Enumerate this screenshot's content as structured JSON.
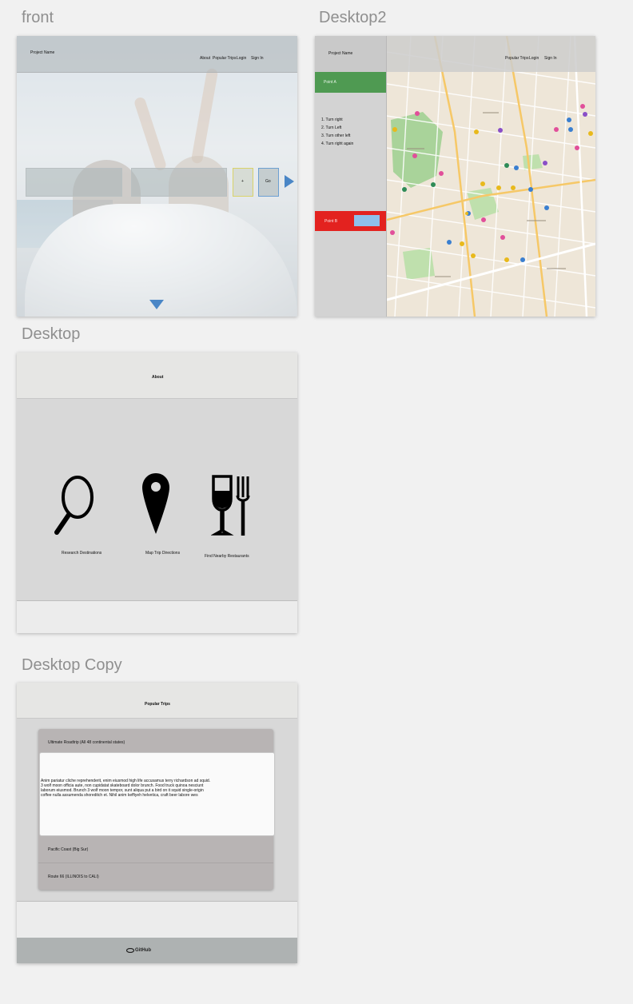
{
  "artboards": {
    "front": {
      "title": "front",
      "project_name": "Project Name",
      "nav": [
        "About",
        "Popular Trips",
        "Login",
        "Sign In"
      ],
      "plus_label": "+",
      "go_label": "Go"
    },
    "desktop2": {
      "title": "Desktop2",
      "project_name": "Project Name",
      "nav": [
        "Popular Trips",
        "Login",
        "Sign In"
      ],
      "point_a": "Point A",
      "point_b": "Point B",
      "directions": [
        "1. Turn right",
        "2. Turn Left",
        "3. Turn other left",
        "4. Turn right again"
      ]
    },
    "desktop": {
      "title": "Desktop",
      "heading": "About",
      "features": [
        "Research Destinations",
        "Map Trip Directions",
        "Find Nearby Restaurants"
      ]
    },
    "desktop_copy": {
      "title": "Desktop Copy",
      "heading": "Popular Trips",
      "trips": [
        "Ultimate Roadtrip (All 48 continental states)",
        "Pacific Coast (Big Sur)",
        "Route 66 (ILLINOIS to CALI)"
      ],
      "body_lines": [
        "Anim pariatur cliche reprehenderit, enim eiusmod high life accusamus terry richardson ad squid.",
        "3 wolf moon officia aute, non cupidatat skateboard dolor brunch. Food truck quinoa nesciunt",
        "laborum eiusmod. Brunch 3 wolf moon tempor, sunt aliqua put a bird on it squid single-origin",
        "coffee nulla assumenda shoreditch et. Nihil anim keffiyeh helvetica, craft beer labore wes"
      ],
      "footer_logo": "GitHub"
    }
  },
  "colors": {
    "point_a": "#4f9a52",
    "point_b": "#e3221f",
    "accent_blue": "#4a86c6"
  }
}
